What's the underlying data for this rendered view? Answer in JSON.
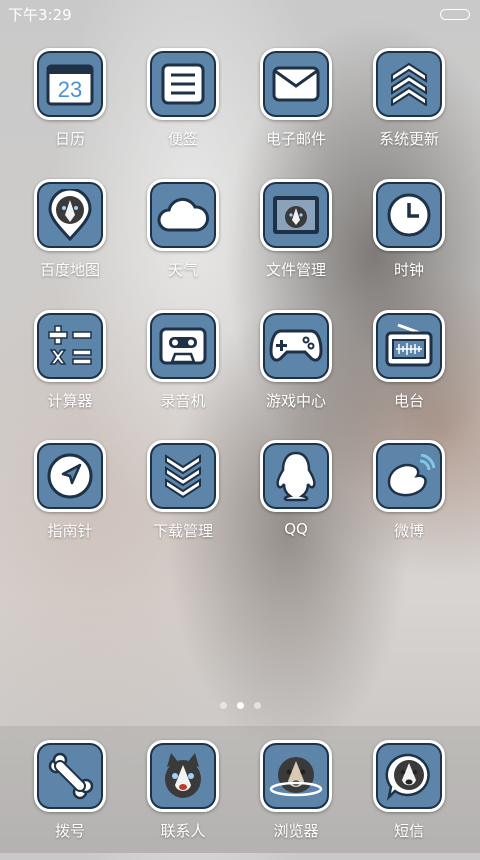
{
  "status_bar": {
    "time": "下午3:29"
  },
  "colors": {
    "tile_bg": "#5d84a9",
    "tile_border": "#ffffff",
    "icon_dark": "#1e3147"
  },
  "apps": [
    {
      "label": "日历",
      "icon": "calendar-icon",
      "badge": "23"
    },
    {
      "label": "便签",
      "icon": "notes-icon"
    },
    {
      "label": "电子邮件",
      "icon": "mail-icon"
    },
    {
      "label": "系统更新",
      "icon": "update-chevrons-icon"
    },
    {
      "label": "百度地图",
      "icon": "map-pin-husky-icon"
    },
    {
      "label": "天气",
      "icon": "cloud-icon"
    },
    {
      "label": "文件管理",
      "icon": "file-manager-husky-icon"
    },
    {
      "label": "时钟",
      "icon": "clock-icon"
    },
    {
      "label": "计算器",
      "icon": "calculator-icon"
    },
    {
      "label": "录音机",
      "icon": "cassette-icon"
    },
    {
      "label": "游戏中心",
      "icon": "gamepad-icon"
    },
    {
      "label": "电台",
      "icon": "radio-icon"
    },
    {
      "label": "指南针",
      "icon": "compass-arrow-icon"
    },
    {
      "label": "下载管理",
      "icon": "download-chevrons-icon"
    },
    {
      "label": "QQ",
      "icon": "penguin-icon"
    },
    {
      "label": "微博",
      "icon": "weibo-icon"
    }
  ],
  "page_indicator": {
    "count": 3,
    "active": 2
  },
  "dock": [
    {
      "label": "拨号",
      "icon": "bone-icon"
    },
    {
      "label": "联系人",
      "icon": "husky-face-icon"
    },
    {
      "label": "浏览器",
      "icon": "husky-planet-icon"
    },
    {
      "label": "短信",
      "icon": "husky-bubble-icon"
    }
  ]
}
